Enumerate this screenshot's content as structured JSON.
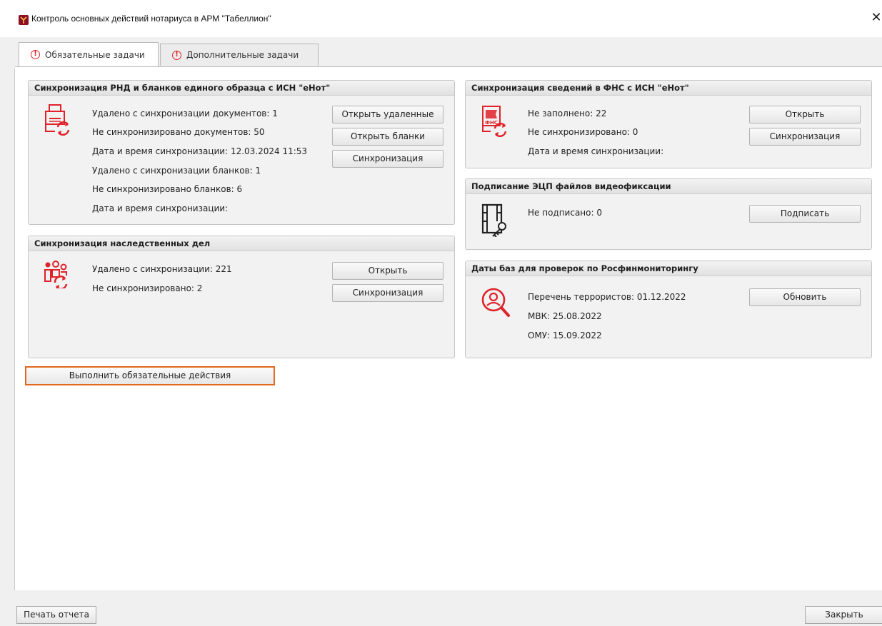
{
  "window": {
    "title": "Контроль основных действий нотариуса в АРМ \"Табеллион\"",
    "close_symbol": "✕"
  },
  "tabs": [
    {
      "label": "Обязательные задачи",
      "warn": "!"
    },
    {
      "label": "Дополнительные задачи",
      "warn": "!"
    }
  ],
  "panels": {
    "rnd": {
      "title": "Синхронизация РНД и бланков единого образца с ИСН \"еНот\"",
      "icon": "printer-sync-icon",
      "lines": [
        "Удалено с синхронизации документов: 1",
        "Не синхронизировано документов: 50",
        "Дата и время синхронизации: 12.03.2024 11:53",
        "Удалено с синхронизации бланков: 1",
        "Не синхронизировано бланков: 6",
        "Дата и время синхронизации:"
      ],
      "buttons": [
        "Открыть удаленные",
        "Открыть бланки",
        "Синхронизация"
      ]
    },
    "inheritance": {
      "title": "Синхронизация наследственных дел",
      "icon": "people-sync-icon",
      "lines": [
        "Удалено с синхронизации: 221",
        "Не синхронизировано: 2"
      ],
      "buttons": [
        "Открыть",
        "Синхронизация"
      ]
    },
    "fns": {
      "title": "Синхронизация сведений в ФНС с ИСН \"еНот\"",
      "icon": "fns-document-sync-icon",
      "icon_text": "ФНС",
      "lines": [
        "Не заполнено: 22",
        "Не синхронизировано: 0",
        "Дата и время синхронизации:"
      ],
      "buttons": [
        "Открыть",
        "Синхронизация"
      ]
    },
    "video": {
      "title": "Подписание ЭЦП файлов видеофиксации",
      "icon": "film-key-icon",
      "lines": [
        "Не подписано: 0"
      ],
      "buttons": [
        "Подписать"
      ]
    },
    "rfm": {
      "title": "Даты баз для проверок по Росфинмониторингу",
      "icon": "person-search-icon",
      "lines": [
        "Перечень террористов: 01.12.2022",
        "МВК: 25.08.2022",
        "ОМУ: 15.09.2022"
      ],
      "buttons": [
        "Обновить"
      ]
    }
  },
  "actions": {
    "execute_required": "Выполнить обязательные действия"
  },
  "footer": {
    "print_report": "Печать отчета",
    "close": "Закрыть"
  },
  "colors": {
    "accent_red": "#e0222a",
    "highlight_orange": "#e2691d",
    "app_icon": "#8b1024"
  }
}
